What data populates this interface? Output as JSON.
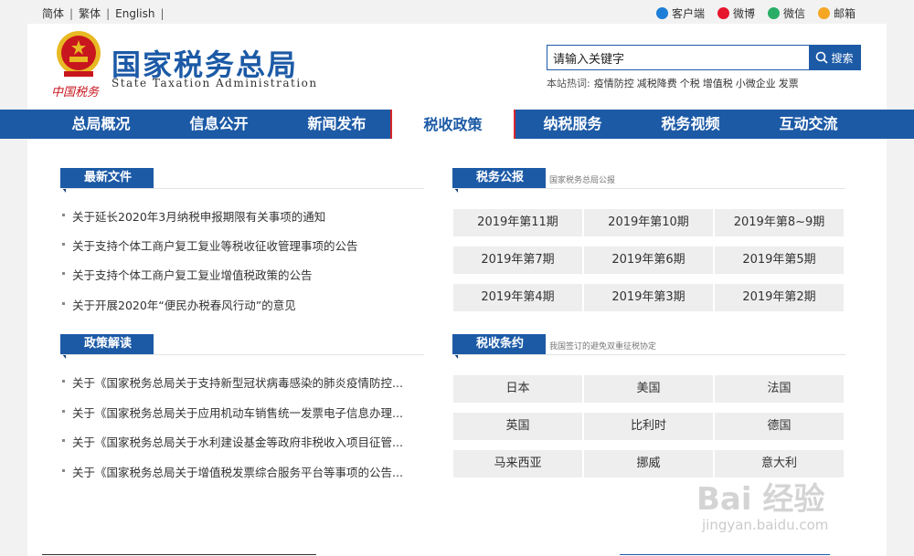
{
  "topbar": {
    "lang_simplified": "简体",
    "lang_traditional": "繁体",
    "lang_english": "English",
    "social": [
      {
        "label": "客户端",
        "icon": "mobile-client-icon",
        "color": "#1c7ed6"
      },
      {
        "label": "微博",
        "icon": "weibo-icon",
        "color": "#e6162d"
      },
      {
        "label": "微信",
        "icon": "wechat-icon",
        "color": "#2aae67"
      },
      {
        "label": "邮箱",
        "icon": "mail-icon",
        "color": "#f5a623"
      }
    ]
  },
  "header": {
    "title_cn": "国家税务总局",
    "title_en": "State Taxation Administration",
    "sub_logo": "中国税务",
    "search_placeholder": "请输入关键字",
    "search_value": "请输入关键字",
    "search_button": "搜索",
    "hot_label": "本站热词:",
    "hot_words": [
      "疫情防控",
      "减税降费",
      "个税",
      "增值税",
      "小微企业",
      "发票"
    ]
  },
  "nav": {
    "items": [
      "总局概况",
      "信息公开",
      "新闻发布",
      "税收政策",
      "纳税服务",
      "税务视频",
      "互动交流"
    ],
    "active_index": 3
  },
  "latest_files": {
    "title": "最新文件",
    "items": [
      "关于延长2020年3月纳税申报期限有关事项的通知",
      "关于支持个体工商户复工复业等税收征收管理事项的公告",
      "关于支持个体工商户复工复业增值税政策的公告",
      "关于开展2020年“便民办税春风行动”的意见"
    ]
  },
  "policy_interpretation": {
    "title": "政策解读",
    "items": [
      "关于《国家税务总局关于支持新型冠状病毒感染的肺炎疫情防控...",
      "关于《国家税务总局关于应用机动车销售统一发票电子信息办理...",
      "关于《国家税务总局关于水利建设基金等政府非税收入项目征管...",
      "关于《国家税务总局关于增值税发票综合服务平台等事项的公告..."
    ]
  },
  "bulletin": {
    "title": "税务公报",
    "note": "国家税务总局公报",
    "issues": [
      "2019年第11期",
      "2019年第10期",
      "2019年第8~9期",
      "2019年第7期",
      "2019年第6期",
      "2019年第5期",
      "2019年第4期",
      "2019年第3期",
      "2019年第2期"
    ]
  },
  "treaties": {
    "title": "税收条约",
    "note": "我国签订的避免双重征税协定",
    "countries": [
      "日本",
      "美国",
      "法国",
      "英国",
      "比利时",
      "德国",
      "马来西亚",
      "挪威",
      "意大利"
    ]
  },
  "watermark": {
    "main": "Bai 经验",
    "url": "jingyan.baidu.com"
  },
  "colors": {
    "brand_blue": "#1c5aa6",
    "active_border": "#d9262b",
    "emblem_red": "#c8161e",
    "emblem_gold": "#e8b923"
  }
}
